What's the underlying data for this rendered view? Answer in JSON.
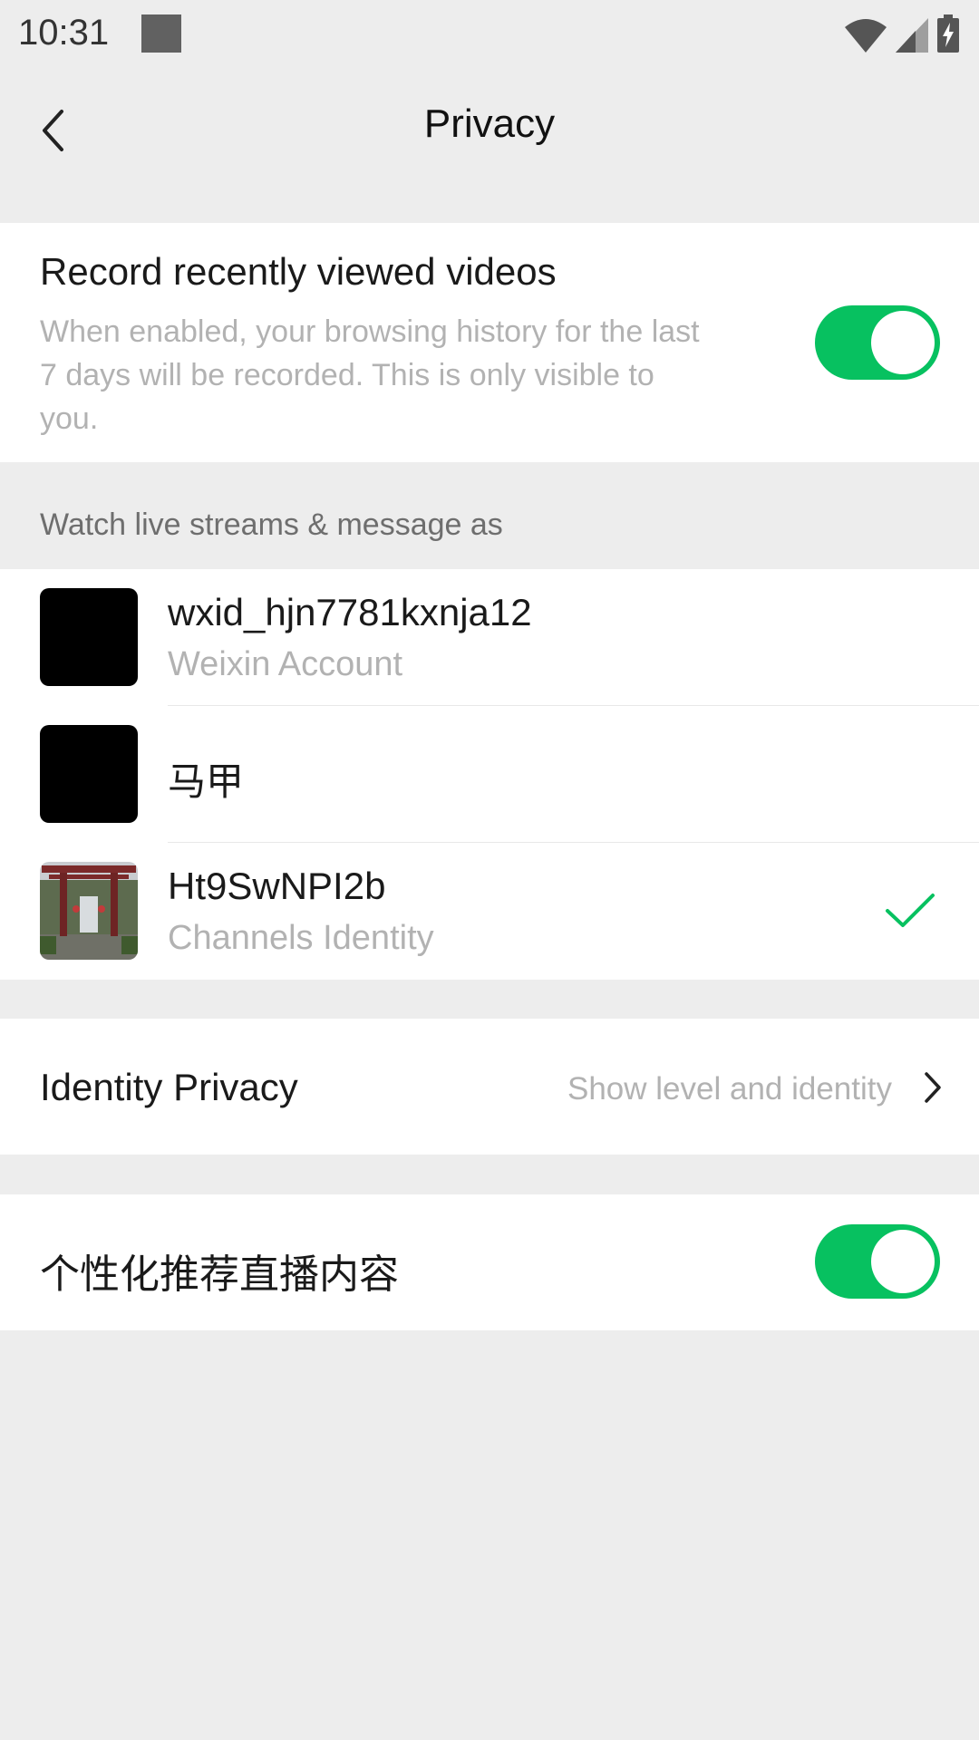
{
  "status_bar": {
    "time": "10:31",
    "icons": [
      "wifi-icon",
      "cell-signal-icon",
      "battery-charging-icon"
    ]
  },
  "header": {
    "title": "Privacy",
    "back_icon": "back-chevron-icon"
  },
  "record_videos": {
    "title": "Record recently viewed videos",
    "description": "When enabled, your browsing history for the last 7 days will be recorded. This is only visible to you.",
    "enabled": true
  },
  "watch_as": {
    "label": "Watch live streams & message as",
    "accounts": [
      {
        "name": "wxid_hjn7781kxnja12",
        "subtitle": "Weixin Account",
        "selected": false
      },
      {
        "name": "马甲",
        "subtitle": "",
        "selected": false
      },
      {
        "name": "Ht9SwNPI2b",
        "subtitle": "Channels Identity",
        "selected": true
      }
    ]
  },
  "identity_privacy": {
    "title": "Identity Privacy",
    "value": "Show level and identity"
  },
  "personalized": {
    "title": "个性化推荐直播内容",
    "enabled": true
  },
  "colors": {
    "accent": "#07c160",
    "background": "#ededed",
    "card": "#ffffff",
    "secondary_text": "#b2b2b2"
  }
}
